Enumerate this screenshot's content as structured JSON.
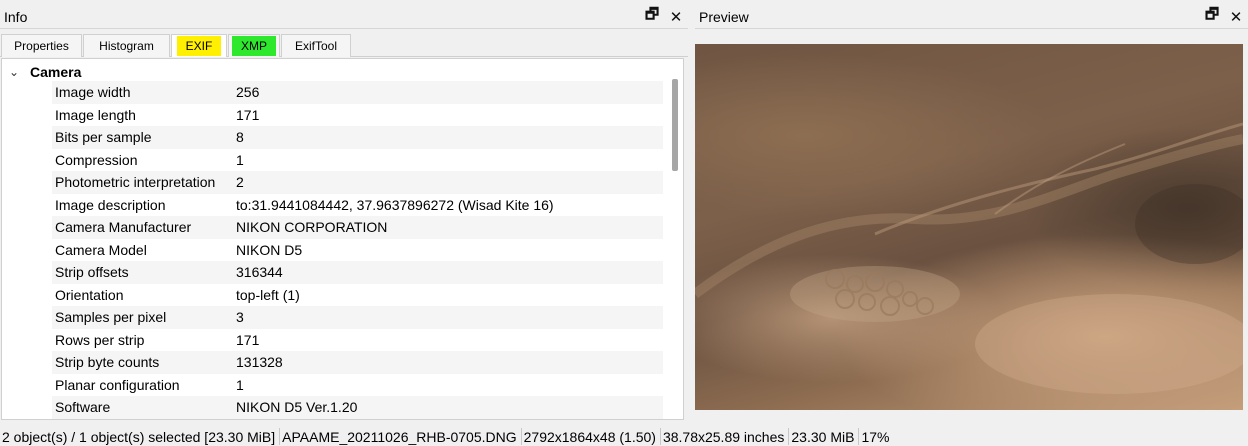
{
  "info_panel": {
    "title": "Info",
    "float_icon": "float-window-icon",
    "close_icon": "close-icon",
    "float_glyph": "🗗",
    "close_glyph": "✕"
  },
  "preview_panel": {
    "title": "Preview",
    "float_glyph": "🗗",
    "close_glyph": "✕"
  },
  "tabs": [
    {
      "label": "Properties"
    },
    {
      "label": "Histogram"
    },
    {
      "label": "EXIF"
    },
    {
      "label": "XMP"
    },
    {
      "label": "ExifTool"
    }
  ],
  "tab_colors": {
    "exif_highlight": "#ffef00",
    "xmp_highlight": "#2ee82e"
  },
  "group": {
    "title": "Camera",
    "chevron": "⌄"
  },
  "rows": [
    {
      "key": "Image width",
      "value": "256"
    },
    {
      "key": "Image length",
      "value": "171"
    },
    {
      "key": "Bits per sample",
      "value": "8"
    },
    {
      "key": "Compression",
      "value": "1"
    },
    {
      "key": "Photometric interpretation",
      "value": "2"
    },
    {
      "key": "Image description",
      "value": "to:31.9441084442, 37.9637896272 (Wisad Kite 16)"
    },
    {
      "key": "Camera Manufacturer",
      "value": "NIKON CORPORATION"
    },
    {
      "key": "Camera Model",
      "value": "NIKON D5"
    },
    {
      "key": "Strip offsets",
      "value": "316344"
    },
    {
      "key": "Orientation",
      "value": "top-left (1)"
    },
    {
      "key": "Samples per pixel",
      "value": "3"
    },
    {
      "key": "Rows per strip",
      "value": "171"
    },
    {
      "key": "Strip byte counts",
      "value": "131328"
    },
    {
      "key": "Planar configuration",
      "value": "1"
    },
    {
      "key": "Software",
      "value": "NIKON D5 Ver.1.20"
    }
  ],
  "status": {
    "selection": "2 object(s) / 1 object(s) selected [23.30 MiB]",
    "filename": "APAAME_20211026_RHB-0705.DNG",
    "dimensions": "2792x1864x48 (1.50)",
    "print_size": "38.78x25.89 inches",
    "file_size": "23.30 MiB",
    "zoom": "17%"
  }
}
